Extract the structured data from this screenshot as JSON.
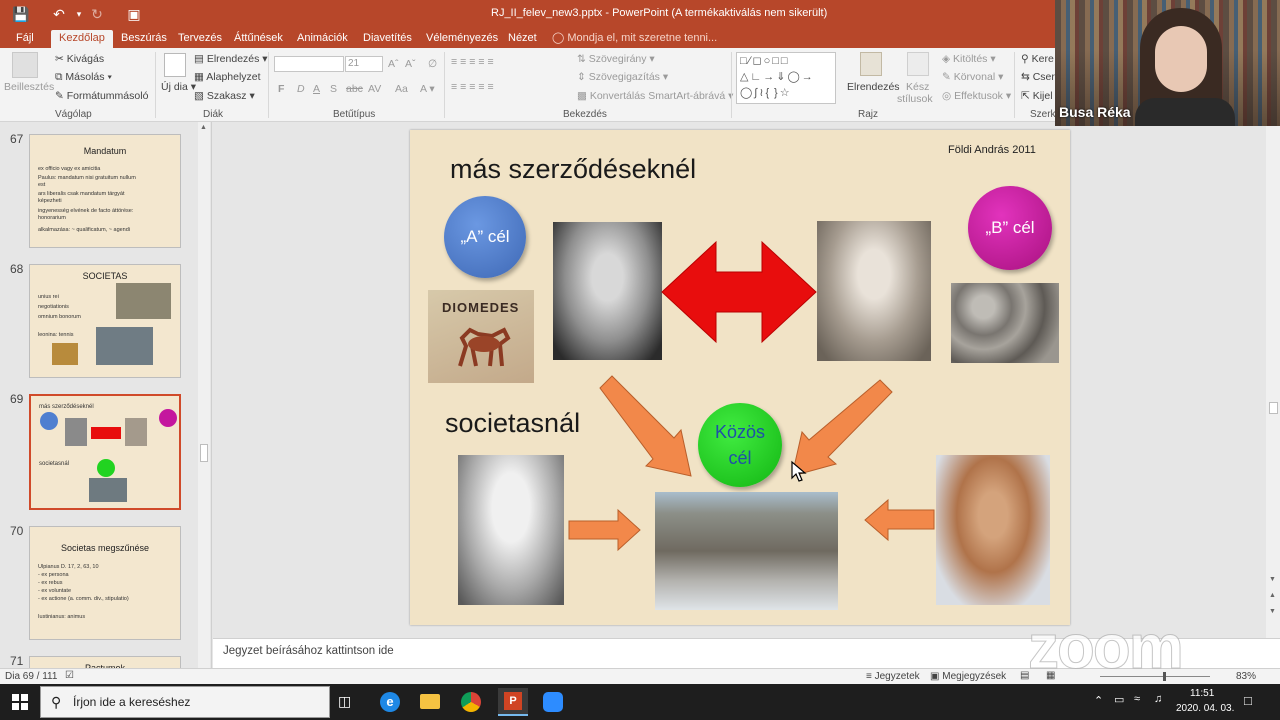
{
  "window": {
    "title": "RJ_II_felev_new3.pptx - PowerPoint (A termékaktiválás nem sikerült)"
  },
  "ribbon_tabs": [
    "Fájl",
    "Kezdőlap",
    "Beszúrás",
    "Tervezés",
    "Áttűnések",
    "Animációk",
    "Diavetítés",
    "Véleményezés",
    "Nézet"
  ],
  "tell_me": "Mondja el, mit szeretne tenni...",
  "ribbon": {
    "clipboard": {
      "paste": "Beillesztés",
      "cut": "Kivágás",
      "copy": "Másolás",
      "format_painter": "Formátummásoló",
      "group": "Vágólap"
    },
    "slides": {
      "new_slide": "Új dia",
      "layout": "Elrendezés",
      "reset": "Alaphelyzet",
      "section": "Szakasz",
      "group": "Diák"
    },
    "font": {
      "size": "21",
      "bold": "F",
      "italic": "D",
      "underline": "A",
      "shadow": "S",
      "strike": "abc",
      "spacing": "AV",
      "case": "Aa",
      "group": "Betűtípus"
    },
    "paragraph": {
      "text_direction": "Szövegirány",
      "align_text": "Szövegigazítás",
      "smartart": "Konvertálás SmartArt-ábrává",
      "group": "Bekezdés"
    },
    "drawing": {
      "arrange": "Elrendezés",
      "quick_styles_1": "Kész",
      "quick_styles_2": "stílusok",
      "fill": "Kitöltés",
      "outline": "Körvonal",
      "effects": "Effektusok",
      "group": "Rajz"
    },
    "editing": {
      "find": "Kere",
      "replace": "Csere",
      "select": "Kijel",
      "group": "Szerke"
    }
  },
  "thumbnails": [
    {
      "number": "67",
      "title": "Mandatum",
      "lines": [
        "ex officio vagy ex amicitia",
        "Paulus: mandatum nisi gratuitum nullum",
        "est",
        "ars liberalis csak mandatum tárgyát",
        "képezheti",
        "ingyenesség elvének de facto áttörése:",
        "honorarium",
        "alkalmazása: ~ qualificatum, ~ agendi"
      ]
    },
    {
      "number": "68",
      "title": "SOCIETAS",
      "lines": [
        "unius rei",
        "negotiationis",
        "omnium bonorum",
        "leonina: tennis"
      ]
    },
    {
      "number": "69",
      "title": "más szerződéseknél",
      "lines": [
        "societasnál"
      ]
    },
    {
      "number": "70",
      "title": "Societas megszűnése",
      "lines": [
        "Ulpianus D. 17, 2, 63, 10",
        "- ex persona",
        "- ex rebus",
        "- ex voluntate",
        "- ex actione (a. comm. div., stipulatio)",
        "",
        "Iustinianus: animus"
      ]
    },
    {
      "number": "71",
      "title": "Pactumok",
      "lines": []
    }
  ],
  "slide": {
    "author": "Földi András 2011",
    "heading_top": "más szerződéseknél",
    "heading_bottom": "societasnál",
    "circle_a": "„A” cél",
    "circle_b": "„B” cél",
    "circle_common_1": "Közös",
    "circle_common_2": "cél",
    "mosaic_text": "DIOMEDES"
  },
  "notes_placeholder": "Jegyzet beírásához kattintson ide",
  "status": {
    "slide_counter": "Dia 69 / 111",
    "notes": "Jegyzetek",
    "comments": "Megjegyzések",
    "zoom": "83%"
  },
  "taskbar": {
    "search_placeholder": "Írjon ide a kereséshez",
    "time": "11:51",
    "date": "2020. 04. 03."
  },
  "video": {
    "participant_name": "Busa Réka",
    "watermark": "zoom"
  },
  "colors": {
    "accent": "#b7472a",
    "slide_bg": "#f1e3c6",
    "circle_a": "#4f7fd0",
    "circle_b": "#c4169e",
    "circle_common": "#21d321",
    "arrow_red": "#e80d0d",
    "arrow_orange": "#f2884a"
  }
}
